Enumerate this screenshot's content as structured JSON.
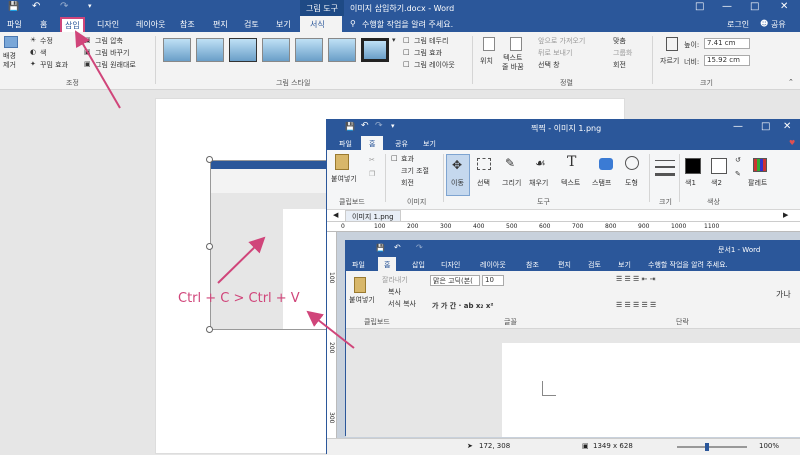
{
  "word": {
    "title_left": "그림 도구",
    "title": "이미지 삽입하기.docx - Word",
    "tabs": [
      "파일",
      "홈",
      "삽입",
      "디자인",
      "레이아웃",
      "참조",
      "편지",
      "검토",
      "보기",
      "서식"
    ],
    "tell_me": "수행할 작업을 알려 주세요.",
    "login": "로그인",
    "share": "공유",
    "ribbon": {
      "remove_bg": "배경\n제거",
      "correct": "수정",
      "color": "색",
      "artistic": "꾸밈 효과",
      "compress": "그림 압축",
      "change": "그림 바꾸기",
      "reset": "그림 원래대로",
      "adjust_group": "조정",
      "styles_group": "그림 스타일",
      "border": "그림 테두리",
      "effects": "그림 효과",
      "layout": "그림 레이아웃",
      "position": "위치",
      "wrap": "텍스트\n줄 바꿈",
      "bring_forward": "앞으로 가져오기",
      "send_backward": "뒤로 보내기",
      "selection_pane": "선택 창",
      "align": "맞춤",
      "group": "그룹화",
      "rotate": "회전",
      "arrange_group": "정렬",
      "crop": "자르기",
      "height_label": "높이:",
      "height": "7.41 cm",
      "width_label": "너비:",
      "width": "15.92 cm",
      "size_group": "크기"
    }
  },
  "annotation": "Ctrl + C > Ctrl + V",
  "paint": {
    "title": "찍찍 - 이미지 1.png",
    "tabs": [
      "파일",
      "홈",
      "공유",
      "보기"
    ],
    "ribbon": {
      "paste": "붙여넣기",
      "clipboard_group": "클립보드",
      "select_icon_labels": [
        "효과",
        "크기 조절",
        "회전"
      ],
      "image_group": "이미지",
      "move": "이동",
      "select": "선택",
      "draw": "그리기",
      "fill": "채우기",
      "text": "텍스트",
      "stamp": "스탬프",
      "shape": "도형",
      "tools_group": "도구",
      "size_group": "크기",
      "color1": "색1",
      "color2": "색2",
      "palette": "팔레트",
      "color_group": "색상"
    },
    "file_tab": "이미지 1.png",
    "ruler": [
      "0",
      "100",
      "200",
      "300",
      "400",
      "500",
      "600",
      "700",
      "800",
      "900",
      "1000",
      "1100"
    ],
    "vruler": [
      "100",
      "200",
      "300"
    ],
    "status_pos": "172, 308",
    "status_size": "1349 x 628",
    "zoom": "100%"
  },
  "inner_word": {
    "title": "문서1 - Word",
    "tabs": [
      "파일",
      "홈",
      "삽입",
      "디자인",
      "레이아웃",
      "참조",
      "편지",
      "검토",
      "보기"
    ],
    "tell_me": "수행할 작업을 알려 주세요.",
    "paste": "붙여넣기",
    "cut": "잘라내기",
    "copy": "복사",
    "format_painter": "서식 복사",
    "clipboard_group": "클립보드",
    "font": "맑은 고딕(본(",
    "font_size": "10",
    "font_group": "글꼴",
    "para_group": "단락",
    "style_preview": "가나"
  }
}
